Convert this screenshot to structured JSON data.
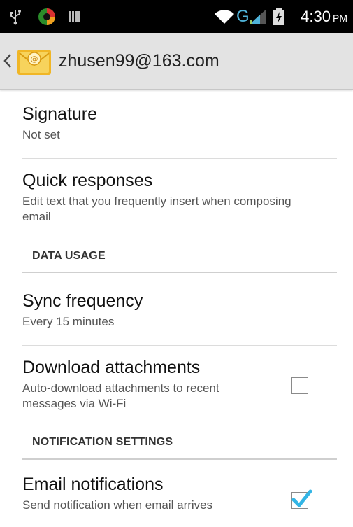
{
  "status_bar": {
    "time": "4:30",
    "ampm": "PM",
    "icons": [
      "usb-icon",
      "app-notification-icon",
      "battery-storage-icon",
      "wifi-icon",
      "network-g-icon",
      "signal-icon",
      "battery-icon"
    ],
    "network_type": "G"
  },
  "action_bar": {
    "title": "zhusen99@163.com",
    "icons": [
      "back-chevron-icon",
      "email-app-icon"
    ]
  },
  "settings": {
    "signature": {
      "title": "Signature",
      "summary": "Not set"
    },
    "quick_responses": {
      "title": "Quick responses",
      "summary": "Edit text that you frequently insert when composing email"
    },
    "data_usage_header": "DATA USAGE",
    "sync_frequency": {
      "title": "Sync frequency",
      "summary": "Every 15 minutes"
    },
    "download_attachments": {
      "title": "Download attachments",
      "summary": "Auto-download attachments to recent messages via Wi-Fi",
      "checked": false
    },
    "notification_header": "NOTIFICATION SETTINGS",
    "email_notifications": {
      "title": "Email notifications",
      "summary": "Send notification when email arrives",
      "checked": true
    }
  },
  "colors": {
    "status_bar_bg": "#000000",
    "action_bar_bg": "#e3e3e3",
    "checkbox_check": "#33b5e5",
    "network_accent": "#4fb3d9"
  }
}
